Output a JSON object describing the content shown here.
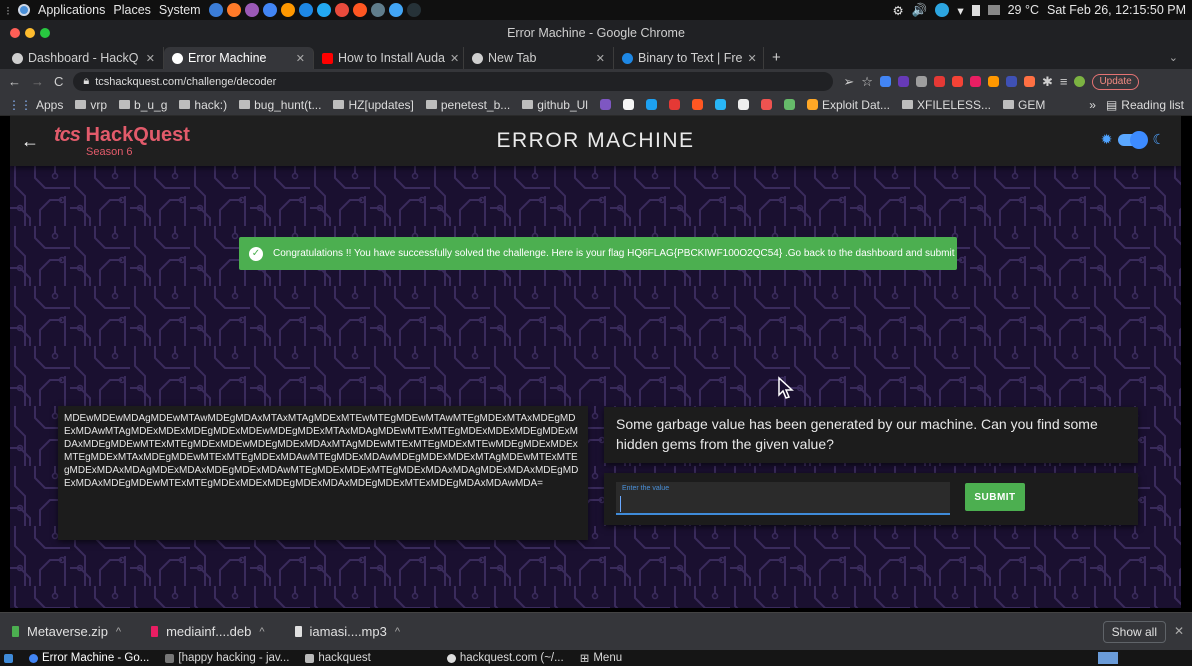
{
  "system_panel": {
    "menus": [
      "Applications",
      "Places",
      "System"
    ],
    "weather": "29 °C",
    "datetime": "Sat Feb 26, 12:15:50 PM"
  },
  "window": {
    "title": "Error Machine - Google Chrome"
  },
  "tabs": [
    {
      "label": "Dashboard - HackQ",
      "active": false
    },
    {
      "label": "Error Machine",
      "active": true
    },
    {
      "label": "How to Install Auda",
      "active": false
    },
    {
      "label": "New Tab",
      "active": false
    },
    {
      "label": "Binary to Text | Fre",
      "active": false
    }
  ],
  "toolbar": {
    "url": "tcshackquest.com/challenge/decoder",
    "update_label": "Update"
  },
  "bookmarks": {
    "items": [
      "Apps",
      "vrp",
      "b_u_g",
      "hack:)",
      "bug_hunt(t...",
      "HZ[updates]",
      "penetest_b...",
      "github_Ul",
      "Exploit Dat...",
      "XFILELESS...",
      "GEM"
    ],
    "more": "»",
    "reading_list": "Reading list"
  },
  "page": {
    "logo": {
      "tcs": "tcs",
      "brand": "HackQuest",
      "season": "Season 6"
    },
    "title": "ERROR MACHINE",
    "alert": "Congratulations !! You have successfully solved the challenge. Here is your flag HQ6FLAG{PBCKIWF100O2QC54} .Go back to the dashboard and submit this",
    "encoded_value": "MDEwMDEwMDAgMDEwMTAwMDEgMDAxMTAxMTAgMDExMTEwMTEgMDEwMTAwMTEgMDExMTAxMDEgMDExMDAwMTAgMDExMDExMDEgMDExMDEwMDEgMDExMTAxMDAgMDEwMTExMTEgMDExMDExMDEgMDExMDAxMDEgMDEwMTExMTEgMDExMDEwMDEgMDExMDAxMTAgMDEwMTExMTEgMDExMTEwMDEgMDExMDExMTEgMDExMTAxMDEgMDEwMTExMTEgMDExMDAwMTEgMDExMDAwMDEgMDExMDExMTAgMDEwMTExMTEgMDExMDAxMDAgMDExMDAxMDEgMDExMDAwMTEgMDExMDExMTEgMDExMDAxMDAgMDExMDAxMDEgMDExMDAxMDEgMDEwMTExMTEgMDExMDExMDEgMDExMDAxMDEgMDExMTExMDEgMDAxMDAwMDA=",
    "question": "Some garbage value has been generated by our machine. Can you find some hidden gems from the given value?",
    "input_label": "Enter the value",
    "input_value": "",
    "submit_label": "SUBMIT"
  },
  "downloads": {
    "items": [
      {
        "name": "Metaverse.zip",
        "color": "#4caf50"
      },
      {
        "name": "mediainf....deb",
        "color": "#e91e63"
      },
      {
        "name": "iamasi....mp3",
        "color": "#e0e0e0"
      }
    ],
    "show_all": "Show all"
  },
  "taskbar": {
    "items": [
      "Error Machine - Go...",
      "[happy hacking - jav...",
      "hackquest",
      "hackquest.com (~/...",
      "Menu"
    ]
  },
  "colors": {
    "accent_green": "#4caf50",
    "brand_red": "#e25b6b",
    "toggle_blue": "#3d8bff",
    "page_bg": "#1a1030"
  }
}
